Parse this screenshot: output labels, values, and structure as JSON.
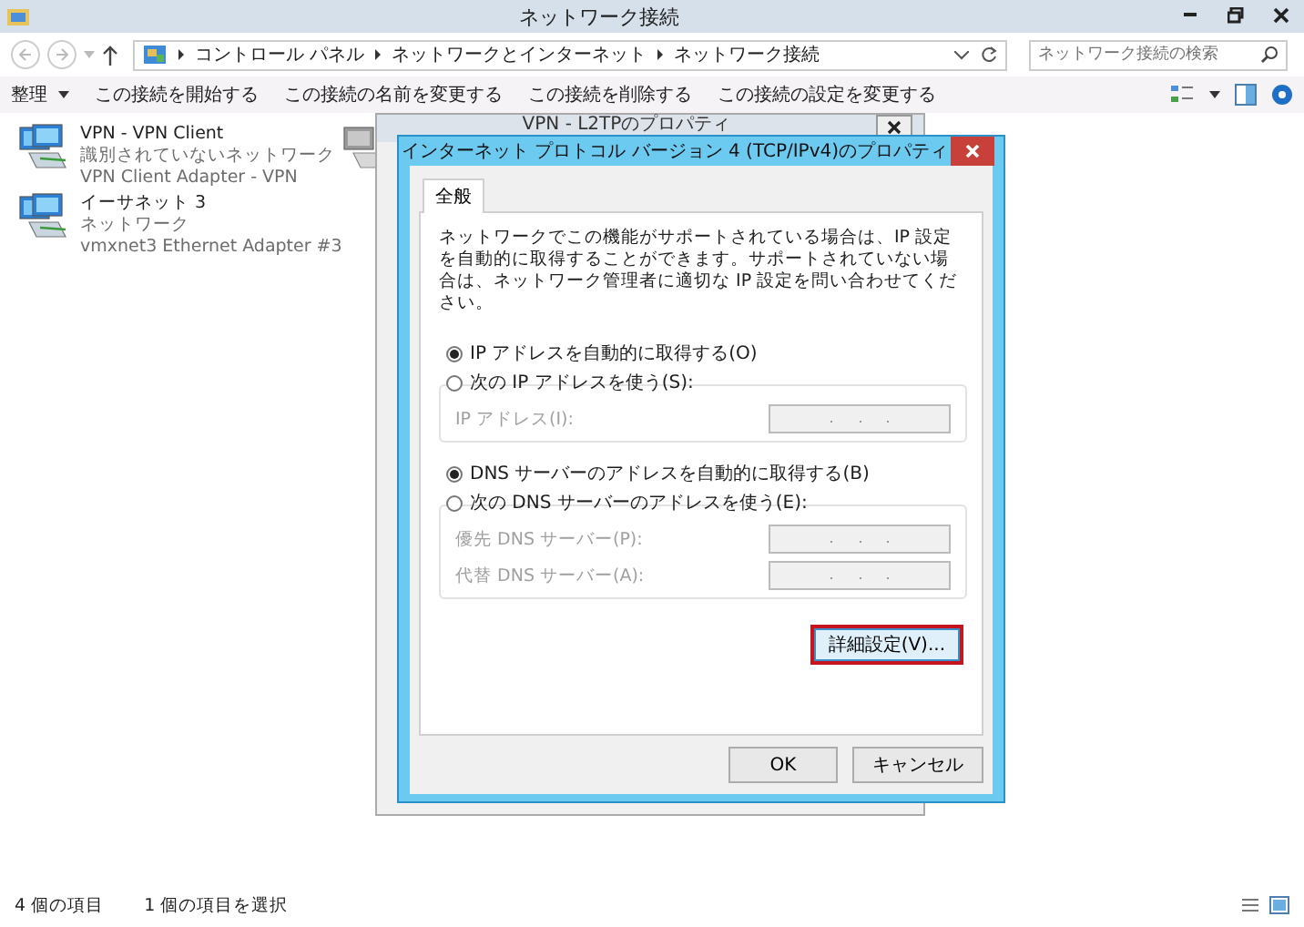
{
  "window": {
    "title": "ネットワーク接続"
  },
  "address_bar": {
    "path": [
      "コントロール パネル",
      "ネットワークとインターネット",
      "ネットワーク接続"
    ]
  },
  "search": {
    "placeholder": "ネットワーク接続の検索"
  },
  "command_bar": [
    {
      "label": "整理",
      "kind": "menu"
    },
    {
      "label": "この接続を開始する",
      "kind": "command"
    },
    {
      "label": "この接続の名前を変更する",
      "kind": "command"
    },
    {
      "label": "この接続を削除する",
      "kind": "command"
    },
    {
      "label": "この接続の設定を変更する",
      "kind": "command"
    }
  ],
  "connections": [
    {
      "name": "VPN - VPN Client",
      "status": "識別されていないネットワーク",
      "adapter": "VPN Client Adapter - VPN"
    },
    {
      "name": "イーサネット 3",
      "status": "ネットワーク",
      "adapter": "vmxnet3 Ethernet Adapter #3"
    }
  ],
  "back_dialog": {
    "title": "VPN - L2TPのプロパティ"
  },
  "dialog": {
    "title": "インターネット プロトコル バージョン 4 (TCP/IPv4)のプロパティ",
    "tabs": [
      {
        "label": "全般",
        "selected": true
      }
    ],
    "description": "ネットワークでこの機能がサポートされている場合は、IP 設定を自動的に取得することができます。サポートされていない場合は、ネットワーク管理者に適切な IP 設定を問い合わせてください。",
    "sections": [
      {
        "auto_option": {
          "label": "IP アドレスを自動的に取得する(O)",
          "selected": true
        },
        "manual_option": {
          "label": "次の IP アドレスを使う(S):",
          "selected": false
        },
        "fields": [
          {
            "label": "IP アドレス(I):",
            "disabled": true
          }
        ]
      },
      {
        "auto_option": {
          "label": "DNS サーバーのアドレスを自動的に取得する(B)",
          "selected": true
        },
        "manual_option": {
          "label": "次の DNS サーバーのアドレスを使う(E):",
          "selected": false
        },
        "fields": [
          {
            "label": "優先 DNS サーバー(P):",
            "disabled": true
          },
          {
            "label": "代替 DNS サーバー(A):",
            "disabled": true
          }
        ]
      }
    ],
    "advanced_button": {
      "label": "詳細設定(V)...",
      "highlighted": true
    },
    "buttons": [
      "OK",
      "キャンセル"
    ]
  },
  "status_bar": [
    "4 個の項目",
    "1 個の項目を選択"
  ]
}
